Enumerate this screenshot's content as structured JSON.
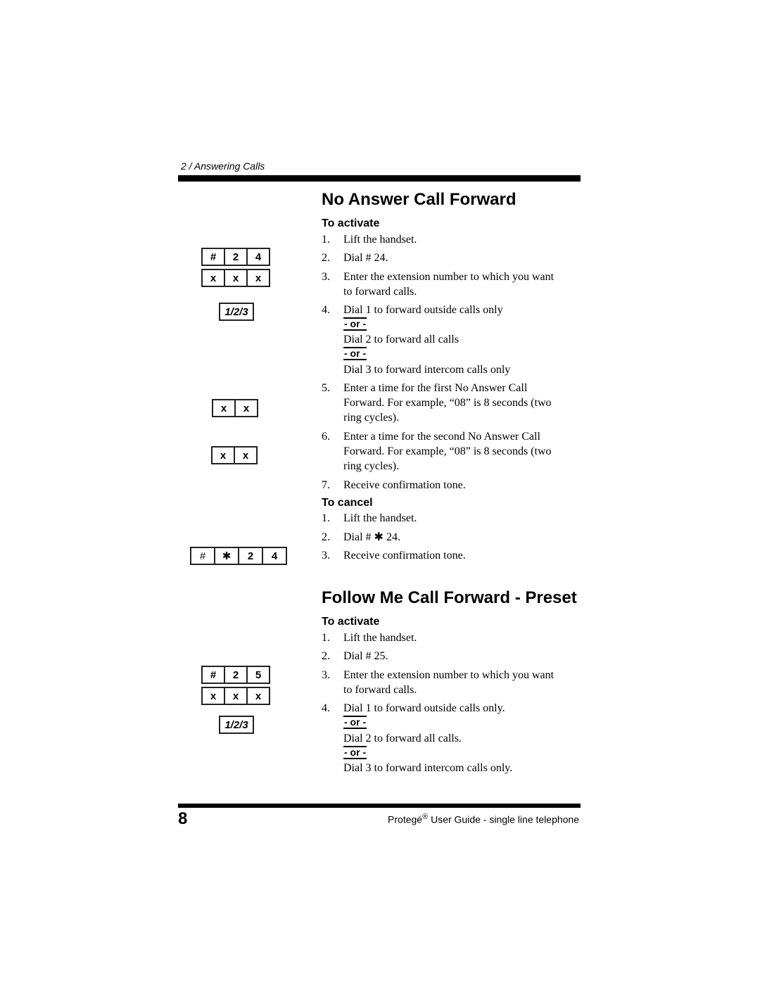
{
  "header": {
    "running_head": "2 / Answering Calls"
  },
  "sections": [
    {
      "title": "No Answer Call Forward",
      "activate": {
        "heading": "To activate",
        "steps": [
          {
            "num": "1.",
            "lines": [
              "Lift the handset."
            ]
          },
          {
            "num": "2.",
            "lines": [
              "Dial # 24."
            ]
          },
          {
            "num": "3.",
            "lines": [
              "Enter the extension number to which you want",
              "to forward calls."
            ]
          },
          {
            "num": "4.",
            "lines": [
              "Dial 1 to forward outside calls only"
            ],
            "alternatives": [
              "Dial 2 to forward all calls",
              "Dial 3 to forward intercom calls only"
            ]
          },
          {
            "num": "5.",
            "lines": [
              "Enter a time for the first No Answer Call",
              "Forward. For example, “08” is 8 seconds (two",
              "ring cycles)."
            ]
          },
          {
            "num": "6.",
            "lines": [
              "Enter a time for the second No Answer Call",
              "Forward. For example, “08” is 8 seconds (two",
              "ring cycles)."
            ]
          },
          {
            "num": "7.",
            "lines": [
              "Receive confirmation tone."
            ]
          }
        ]
      },
      "cancel": {
        "heading": "To cancel",
        "steps": [
          {
            "num": "1.",
            "lines": [
              "Lift the handset."
            ]
          },
          {
            "num": "2.",
            "lines": [
              "Dial # ✱ 24."
            ]
          },
          {
            "num": "3.",
            "lines": [
              "Receive confirmation tone."
            ]
          }
        ]
      },
      "keypads": {
        "dial_code": [
          "#",
          "2",
          "4"
        ],
        "extension": [
          "x",
          "x",
          "x"
        ],
        "option": "1/2/3",
        "first_time": [
          "x",
          "x"
        ],
        "second_time": [
          "x",
          "x"
        ],
        "cancel_code": [
          "#",
          "✱",
          "2",
          "4"
        ]
      }
    },
    {
      "title": "Follow Me Call Forward - Preset",
      "activate": {
        "heading": "To activate",
        "steps": [
          {
            "num": "1.",
            "lines": [
              "Lift the handset."
            ]
          },
          {
            "num": "2.",
            "lines": [
              "Dial # 25."
            ]
          },
          {
            "num": "3.",
            "lines": [
              "Enter the extension number to which you want",
              "to forward calls."
            ]
          },
          {
            "num": "4.",
            "lines": [
              "Dial 1 to forward outside calls only."
            ],
            "alternatives": [
              "Dial 2 to forward all calls.",
              "Dial 3 to forward intercom calls only."
            ]
          }
        ]
      },
      "keypads": {
        "dial_code": [
          "#",
          "2",
          "5"
        ],
        "extension": [
          "x",
          "x",
          "x"
        ],
        "option": "1/2/3"
      }
    }
  ],
  "or_label": "- or -",
  "footer": {
    "page_number": "8",
    "product": "Protegé",
    "registered": "®",
    "title_rest": " User Guide - single line telephone"
  }
}
